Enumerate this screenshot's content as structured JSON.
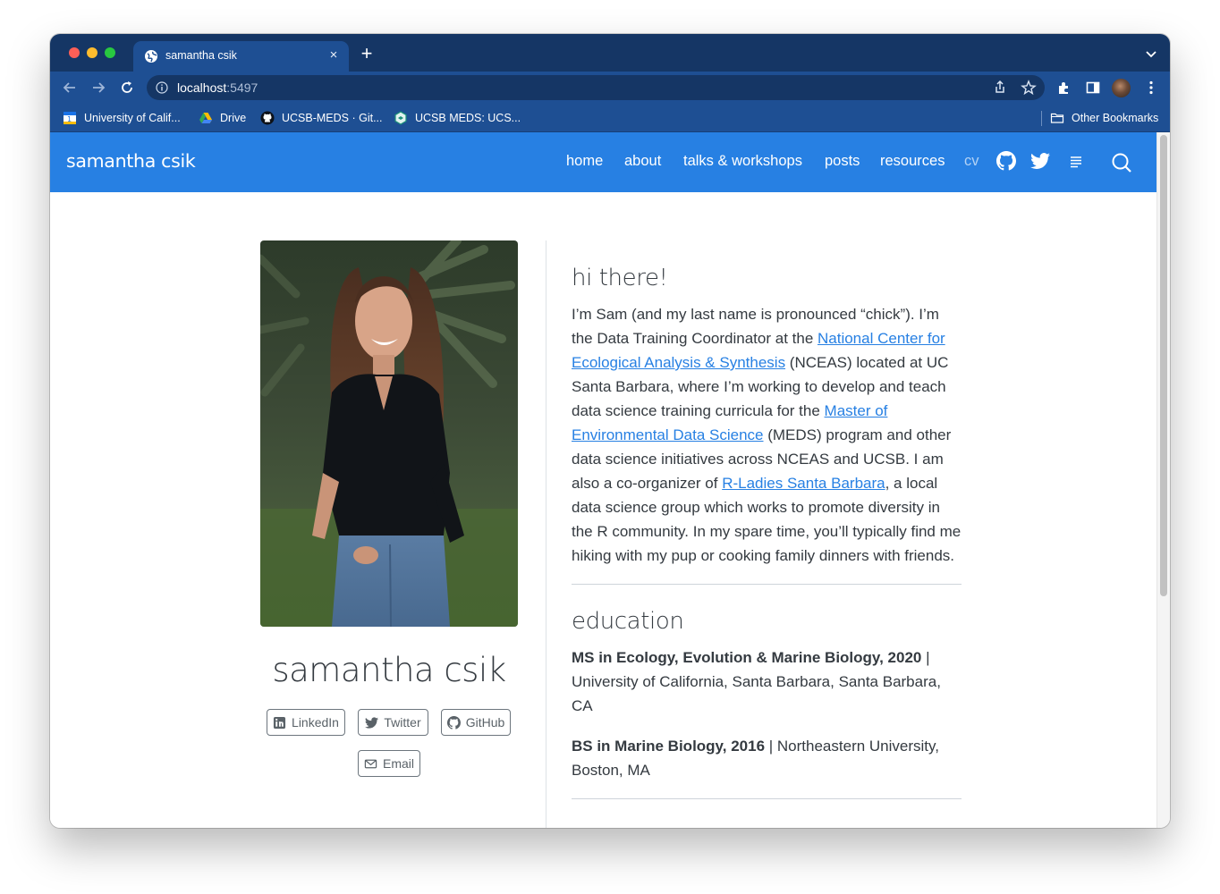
{
  "browser": {
    "tab_title": "samantha csik",
    "new_tab_symbol": "+",
    "close_symbol": "×",
    "url_host": "localhost",
    "url_port": ":5497",
    "bookmarks": [
      {
        "label": "University of Calif..."
      },
      {
        "label": "Drive"
      },
      {
        "label": "UCSB-MEDS · Git..."
      },
      {
        "label": "UCSB MEDS: UCS..."
      }
    ],
    "other_bookmarks": "Other Bookmarks"
  },
  "site": {
    "brand": "samantha csik",
    "nav": [
      {
        "label": "home"
      },
      {
        "label": "about"
      },
      {
        "label": "talks & workshops"
      },
      {
        "label": "posts"
      },
      {
        "label": "resources"
      },
      {
        "label": "cv"
      }
    ],
    "icons": [
      "github-icon",
      "twitter-icon",
      "menu-lines-icon",
      "search-icon"
    ],
    "colors": {
      "navbar": "#2780e3",
      "link": "#2780e3",
      "text": "#343a40"
    }
  },
  "profile": {
    "name": "samantha csik",
    "links": [
      {
        "label": "LinkedIn",
        "icon": "linkedin-icon"
      },
      {
        "label": "Twitter",
        "icon": "twitter-icon"
      },
      {
        "label": "GitHub",
        "icon": "github-icon"
      },
      {
        "label": "Email",
        "icon": "envelope-icon"
      }
    ]
  },
  "intro": {
    "heading": "hi there!",
    "t1": "I’m Sam (and my last name is pronounced “chick”). I’m the Data Training Coordinator at the ",
    "link1": "National Center for Ecological Analysis & Synthesis",
    "t2": " (NCEAS) located at UC Santa Barbara, where I’m working to develop and teach data science training curricula for the ",
    "link2": "Master of Environmental Data Science",
    "t3": " (MEDS) program and other data science initiatives across NCEAS and UCSB. I am also a co-organizer of ",
    "link3": "R-Ladies Santa Barbara",
    "t4": ", a local data science group which works to promote diversity in the R community. In my spare time, you’ll typically find me hiking with my pup or cooking family dinners with friends."
  },
  "education": {
    "heading": "education",
    "items": [
      {
        "degree": "MS in Ecology, Evolution & Marine Biology, 2020",
        "sep": " | ",
        "place": "University of California, Santa Barbara, Santa Barbara, CA"
      },
      {
        "degree": "BS in Marine Biology, 2016",
        "sep": " | ",
        "place": "Northeastern University, Boston, MA"
      }
    ]
  }
}
